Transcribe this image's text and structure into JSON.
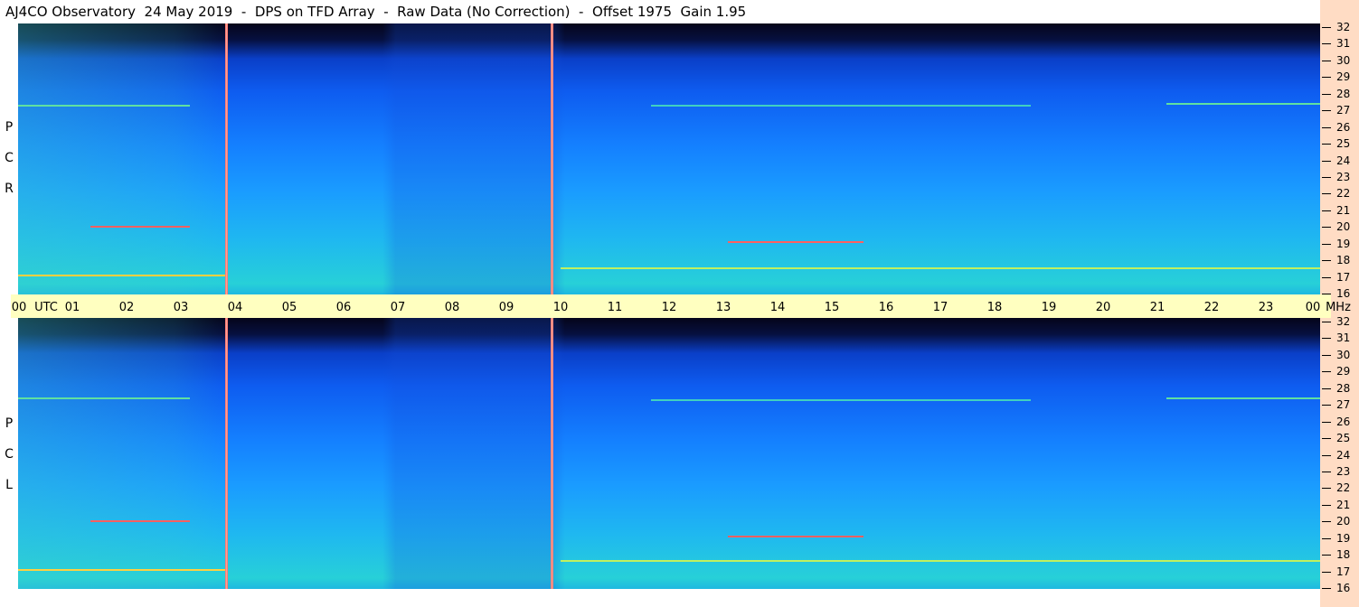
{
  "title": "AJ4CO Observatory  24 May 2019  -  DPS on TFD Array  -  Raw Data (No Correction)  -  Offset 1975  Gain 1.95",
  "panels": [
    {
      "label_letters": [
        "P",
        "C",
        "R"
      ]
    },
    {
      "label_letters": [
        "P",
        "C",
        "L"
      ]
    }
  ],
  "time_axis": {
    "ticks": [
      "00",
      "01",
      "02",
      "03",
      "04",
      "05",
      "06",
      "07",
      "08",
      "09",
      "10",
      "11",
      "12",
      "13",
      "14",
      "15",
      "16",
      "17",
      "18",
      "19",
      "20",
      "21",
      "22",
      "23",
      "00"
    ],
    "utc_label": "UTC",
    "unit_label": "MHz"
  },
  "freq_axis": {
    "ticks": [
      "32",
      "31",
      "30",
      "29",
      "28",
      "27",
      "26",
      "25",
      "24",
      "23",
      "22",
      "21",
      "20",
      "19",
      "18",
      "17",
      "16"
    ]
  },
  "colors": {
    "background_panel": "#ffdcc4",
    "utc_band": "#ffffc0",
    "spectrogram_low": "#05051a",
    "spectrogram_mid": "#1480ff",
    "spectrogram_high": "#27d0d8",
    "interference": "#ff6060"
  }
}
